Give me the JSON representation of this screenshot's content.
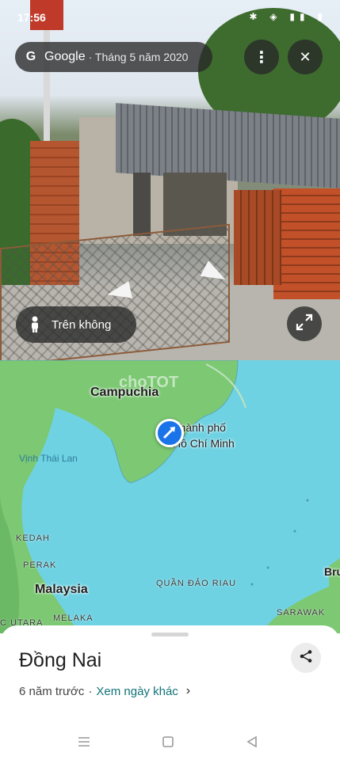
{
  "status_bar": {
    "time": "17:56",
    "icons": "✱ ◈ ▮▮ ▮"
  },
  "streetview_chip": {
    "brand": "Google",
    "date": " · Tháng 5 năm 2020",
    "logo_letter": "G"
  },
  "buttons": {
    "more": "⋮",
    "close": "✕"
  },
  "aerial_button": {
    "label": "Trên không"
  },
  "map": {
    "labels": {
      "cambodia": "Campuchia",
      "hcm_line1": "Thành phố",
      "hcm_line2": "Hồ Chí Minh",
      "gulf": "Vịnh Thái Lan",
      "kedah": "KEDAH",
      "perak": "PERAK",
      "malaysia": "Malaysia",
      "riau": "QUẦN ĐẢO RIAU",
      "sarawak": "SARAWAK",
      "melaka": "MELAKA",
      "c_utara": "C UTARA",
      "brunei_partial": "Bru",
      "watermark": "choTOT"
    },
    "colors": {
      "sea": "#6fd2e3",
      "land": "#7cc873"
    }
  },
  "place": {
    "name": "Đồng Nai",
    "age": "6 năm trước",
    "separator": "·",
    "other_dates_link": "Xem ngày khác"
  }
}
